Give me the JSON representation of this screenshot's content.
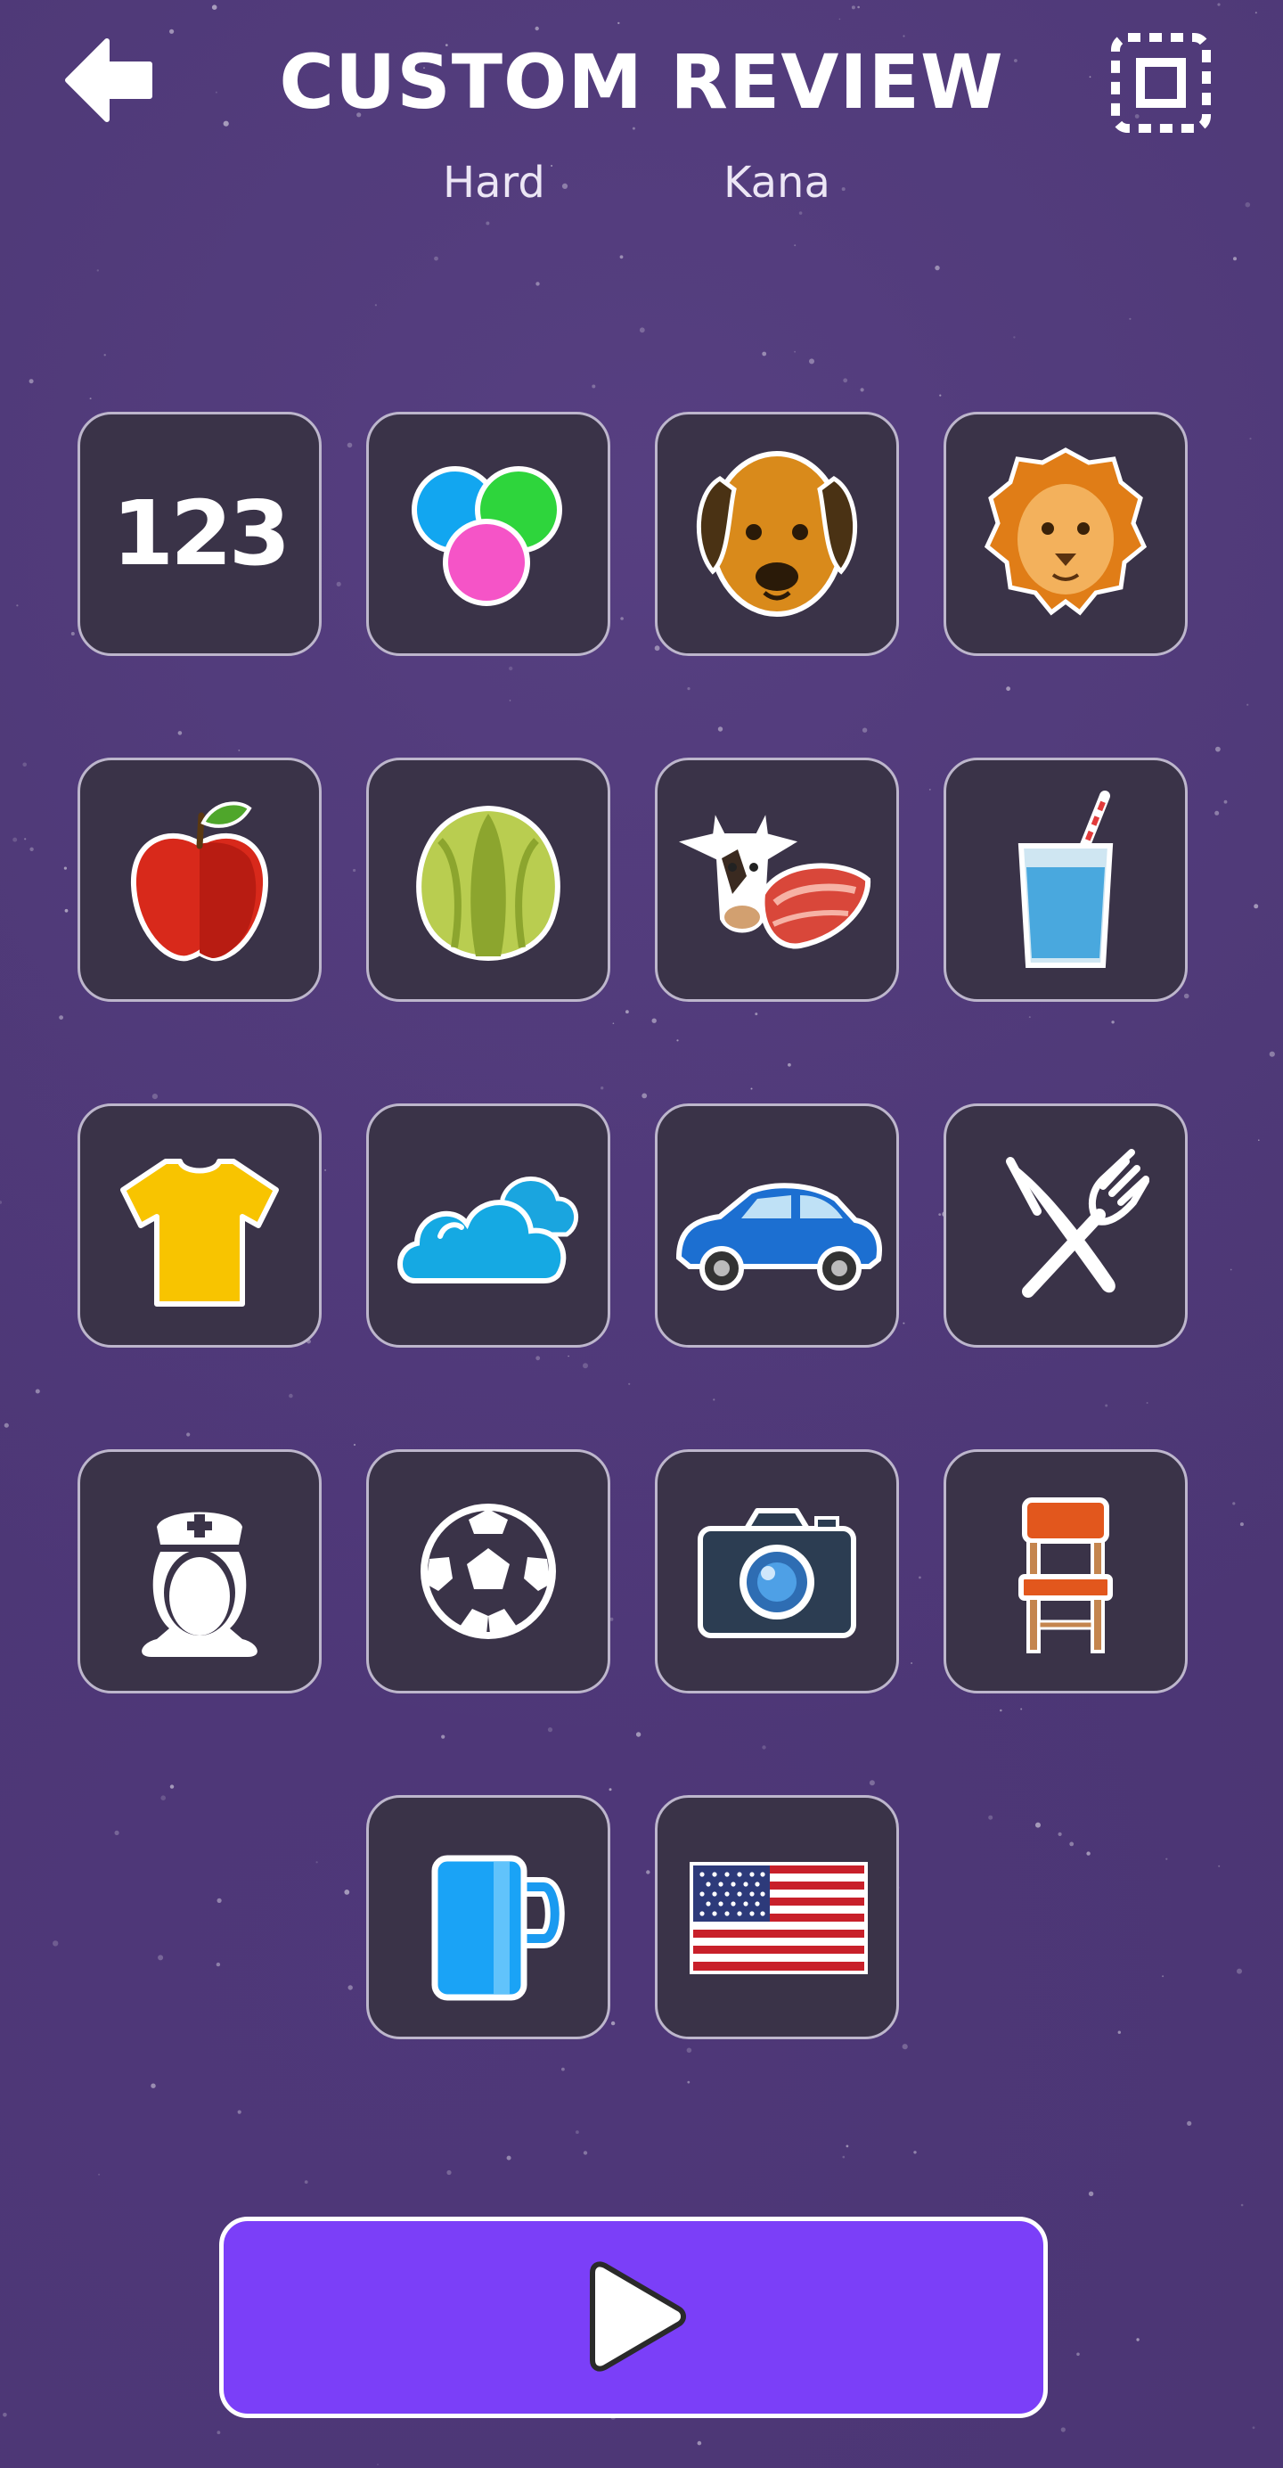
{
  "header": {
    "title": "CUSTOM REVIEW",
    "difficulty": "Hard",
    "script": "Kana",
    "back_icon": "back-arrow-icon",
    "select_icon": "select-all-icon"
  },
  "categories": [
    {
      "id": "numbers",
      "label": "123",
      "icon": "numbers-icon"
    },
    {
      "id": "colors",
      "icon": "colors-icon"
    },
    {
      "id": "dog",
      "icon": "dog-icon"
    },
    {
      "id": "lion",
      "icon": "lion-icon"
    },
    {
      "id": "apple",
      "icon": "apple-icon"
    },
    {
      "id": "cabbage",
      "icon": "cabbage-icon"
    },
    {
      "id": "meat",
      "icon": "cow-meat-icon"
    },
    {
      "id": "drink",
      "icon": "drink-glass-icon"
    },
    {
      "id": "clothes",
      "icon": "tshirt-icon"
    },
    {
      "id": "weather",
      "icon": "cloud-icon"
    },
    {
      "id": "car",
      "icon": "car-icon"
    },
    {
      "id": "utensils",
      "icon": "knife-fork-icon"
    },
    {
      "id": "nurse",
      "icon": "nurse-icon"
    },
    {
      "id": "sports",
      "icon": "soccer-ball-icon"
    },
    {
      "id": "camera",
      "icon": "camera-icon"
    },
    {
      "id": "chair",
      "icon": "chair-icon"
    },
    {
      "id": "mug",
      "icon": "mug-icon"
    },
    {
      "id": "usa",
      "icon": "us-flag-icon"
    }
  ],
  "footer": {
    "play_icon": "play-icon"
  },
  "colors": {
    "background": "#4b3673",
    "tile": "#3a3348",
    "tile_border": "#bdb6cc",
    "play_button": "#7b3ff8"
  }
}
